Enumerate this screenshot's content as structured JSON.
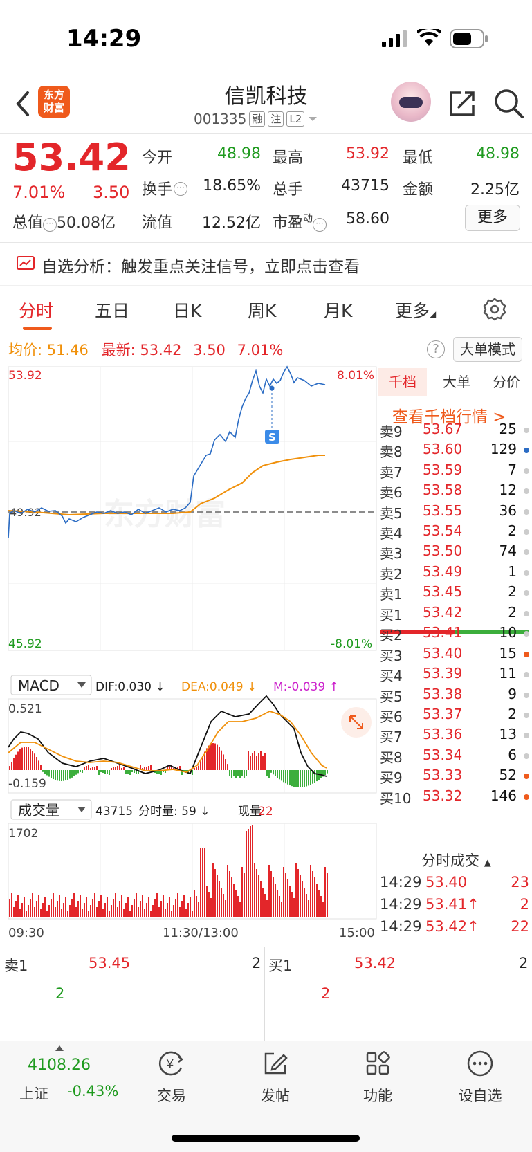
{
  "status": {
    "time": "14:29"
  },
  "header": {
    "logo_line1": "东方",
    "logo_line2": "财富",
    "stock_name": "信凯科技",
    "stock_code": "001335",
    "tags": [
      "融",
      "注",
      "L2"
    ]
  },
  "quote": {
    "price": "53.42",
    "pct": "7.01%",
    "change": "3.50",
    "open_label": "今开",
    "open": "48.98",
    "high_label": "最高",
    "high": "53.92",
    "low_label": "最低",
    "low": "48.98",
    "turnover_label": "换手",
    "turnover": "18.65%",
    "volume_label": "总手",
    "volume": "43715",
    "amount_label": "金额",
    "amount": "2.25亿",
    "mcap_label": "总值",
    "mcap": "50.08亿",
    "float_label": "流值",
    "float": "12.52亿",
    "pe_label": "市盈",
    "pe_sup": "动",
    "pe": "58.60",
    "more": "更多"
  },
  "alert": {
    "text": "自选分析：触发重点关注信号，立即点击查看"
  },
  "tabs": [
    "分时",
    "五日",
    "日K",
    "周K",
    "月K",
    "更多"
  ],
  "intraday": {
    "avg_label": "均价:",
    "avg": "51.46",
    "latest_label": "最新:",
    "latest": "53.42",
    "change": "3.50",
    "pct": "7.01%",
    "big_mode": "大单模式",
    "y_max": "53.92",
    "y_min": "45.92",
    "pct_max": "8.01%",
    "pct_min": "-8.01%",
    "prev_close": "49.92",
    "watermark": "东方财富",
    "marker": "S"
  },
  "macd": {
    "label": "MACD",
    "dif": "DIF:0.030 ↓",
    "dea": "DEA:0.049 ↓",
    "m": "M:-0.039 ↑",
    "max": "0.521",
    "min": "-0.159"
  },
  "vol": {
    "label": "成交量",
    "total": "43715",
    "fsl": "分时量: 59 ↓",
    "now_label": "现量:",
    "now": "22",
    "max": "1702",
    "t0": "09:30",
    "t1": "11:30/13:00",
    "t2": "15:00"
  },
  "orderbook": {
    "tabs": [
      "千档",
      "大单",
      "分价"
    ],
    "more": "查看千档行情 >",
    "asks": [
      {
        "l": "卖9",
        "p": "53.67",
        "v": "25"
      },
      {
        "l": "卖8",
        "p": "53.60",
        "v": "129"
      },
      {
        "l": "卖7",
        "p": "53.59",
        "v": "7"
      },
      {
        "l": "卖6",
        "p": "53.58",
        "v": "12"
      },
      {
        "l": "卖5",
        "p": "53.55",
        "v": "36"
      },
      {
        "l": "卖4",
        "p": "53.54",
        "v": "2"
      },
      {
        "l": "卖3",
        "p": "53.50",
        "v": "74"
      },
      {
        "l": "卖2",
        "p": "53.49",
        "v": "1"
      },
      {
        "l": "卖1",
        "p": "53.45",
        "v": "2"
      }
    ],
    "bids": [
      {
        "l": "买1",
        "p": "53.42",
        "v": "2"
      },
      {
        "l": "买2",
        "p": "53.41",
        "v": "10"
      },
      {
        "l": "买3",
        "p": "53.40",
        "v": "15"
      },
      {
        "l": "买4",
        "p": "53.39",
        "v": "11"
      },
      {
        "l": "买5",
        "p": "53.38",
        "v": "9"
      },
      {
        "l": "买6",
        "p": "53.37",
        "v": "2"
      },
      {
        "l": "买7",
        "p": "53.36",
        "v": "13"
      },
      {
        "l": "买8",
        "p": "53.34",
        "v": "6"
      },
      {
        "l": "买9",
        "p": "53.33",
        "v": "52"
      },
      {
        "l": "买10",
        "p": "53.32",
        "v": "146"
      }
    ],
    "ticks_title": "分时成交",
    "ticks": [
      {
        "t": "14:29",
        "p": "53.40",
        "v": "23"
      },
      {
        "t": "14:29",
        "p": "53.41↑",
        "v": "2"
      },
      {
        "t": "14:29",
        "p": "53.42↑",
        "v": "22"
      }
    ]
  },
  "bottom": {
    "sell_label": "卖1",
    "sell_price": "53.45",
    "sell_vol": "2",
    "buy_label": "买1",
    "buy_price": "53.42",
    "buy_vol": "2",
    "sell_q": "2",
    "buy_q": "2"
  },
  "nav": {
    "index_val": "4108.26",
    "index_name": "上证",
    "index_pct": "-0.43%",
    "items": [
      "交易",
      "发帖",
      "功能",
      "设自选"
    ]
  }
}
